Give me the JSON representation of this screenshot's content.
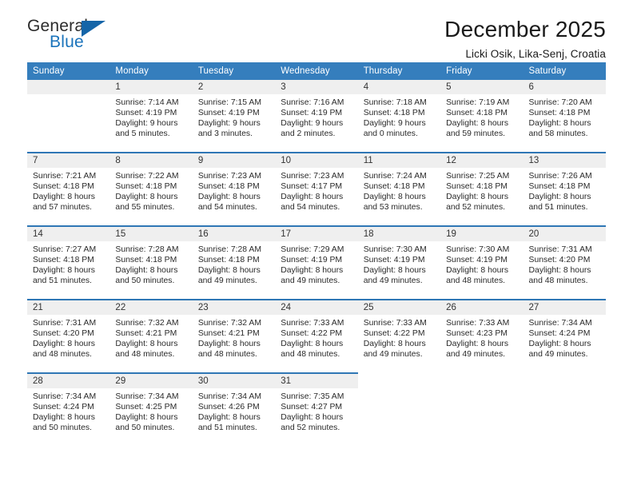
{
  "brand": {
    "name_part1": "General",
    "name_part2": "Blue",
    "triangle_icon": "blue-triangle-icon",
    "accent_color": "#1a73bb"
  },
  "header": {
    "title": "December 2025",
    "subtitle": "Licki Osik, Lika-Senj, Croatia"
  },
  "calendar": {
    "header_bg": "#357ebd",
    "header_text_color": "#ffffff",
    "separator_color": "#2f77b5",
    "daynum_band_bg": "#efefef",
    "weekday_headers": [
      "Sunday",
      "Monday",
      "Tuesday",
      "Wednesday",
      "Thursday",
      "Friday",
      "Saturday"
    ],
    "weeks": [
      [
        {
          "day": "",
          "lines": []
        },
        {
          "day": "1",
          "lines": [
            "Sunrise: 7:14 AM",
            "Sunset: 4:19 PM",
            "Daylight: 9 hours",
            "and 5 minutes."
          ]
        },
        {
          "day": "2",
          "lines": [
            "Sunrise: 7:15 AM",
            "Sunset: 4:19 PM",
            "Daylight: 9 hours",
            "and 3 minutes."
          ]
        },
        {
          "day": "3",
          "lines": [
            "Sunrise: 7:16 AM",
            "Sunset: 4:19 PM",
            "Daylight: 9 hours",
            "and 2 minutes."
          ]
        },
        {
          "day": "4",
          "lines": [
            "Sunrise: 7:18 AM",
            "Sunset: 4:18 PM",
            "Daylight: 9 hours",
            "and 0 minutes."
          ]
        },
        {
          "day": "5",
          "lines": [
            "Sunrise: 7:19 AM",
            "Sunset: 4:18 PM",
            "Daylight: 8 hours",
            "and 59 minutes."
          ]
        },
        {
          "day": "6",
          "lines": [
            "Sunrise: 7:20 AM",
            "Sunset: 4:18 PM",
            "Daylight: 8 hours",
            "and 58 minutes."
          ]
        }
      ],
      [
        {
          "day": "7",
          "lines": [
            "Sunrise: 7:21 AM",
            "Sunset: 4:18 PM",
            "Daylight: 8 hours",
            "and 57 minutes."
          ]
        },
        {
          "day": "8",
          "lines": [
            "Sunrise: 7:22 AM",
            "Sunset: 4:18 PM",
            "Daylight: 8 hours",
            "and 55 minutes."
          ]
        },
        {
          "day": "9",
          "lines": [
            "Sunrise: 7:23 AM",
            "Sunset: 4:18 PM",
            "Daylight: 8 hours",
            "and 54 minutes."
          ]
        },
        {
          "day": "10",
          "lines": [
            "Sunrise: 7:23 AM",
            "Sunset: 4:17 PM",
            "Daylight: 8 hours",
            "and 54 minutes."
          ]
        },
        {
          "day": "11",
          "lines": [
            "Sunrise: 7:24 AM",
            "Sunset: 4:18 PM",
            "Daylight: 8 hours",
            "and 53 minutes."
          ]
        },
        {
          "day": "12",
          "lines": [
            "Sunrise: 7:25 AM",
            "Sunset: 4:18 PM",
            "Daylight: 8 hours",
            "and 52 minutes."
          ]
        },
        {
          "day": "13",
          "lines": [
            "Sunrise: 7:26 AM",
            "Sunset: 4:18 PM",
            "Daylight: 8 hours",
            "and 51 minutes."
          ]
        }
      ],
      [
        {
          "day": "14",
          "lines": [
            "Sunrise: 7:27 AM",
            "Sunset: 4:18 PM",
            "Daylight: 8 hours",
            "and 51 minutes."
          ]
        },
        {
          "day": "15",
          "lines": [
            "Sunrise: 7:28 AM",
            "Sunset: 4:18 PM",
            "Daylight: 8 hours",
            "and 50 minutes."
          ]
        },
        {
          "day": "16",
          "lines": [
            "Sunrise: 7:28 AM",
            "Sunset: 4:18 PM",
            "Daylight: 8 hours",
            "and 49 minutes."
          ]
        },
        {
          "day": "17",
          "lines": [
            "Sunrise: 7:29 AM",
            "Sunset: 4:19 PM",
            "Daylight: 8 hours",
            "and 49 minutes."
          ]
        },
        {
          "day": "18",
          "lines": [
            "Sunrise: 7:30 AM",
            "Sunset: 4:19 PM",
            "Daylight: 8 hours",
            "and 49 minutes."
          ]
        },
        {
          "day": "19",
          "lines": [
            "Sunrise: 7:30 AM",
            "Sunset: 4:19 PM",
            "Daylight: 8 hours",
            "and 48 minutes."
          ]
        },
        {
          "day": "20",
          "lines": [
            "Sunrise: 7:31 AM",
            "Sunset: 4:20 PM",
            "Daylight: 8 hours",
            "and 48 minutes."
          ]
        }
      ],
      [
        {
          "day": "21",
          "lines": [
            "Sunrise: 7:31 AM",
            "Sunset: 4:20 PM",
            "Daylight: 8 hours",
            "and 48 minutes."
          ]
        },
        {
          "day": "22",
          "lines": [
            "Sunrise: 7:32 AM",
            "Sunset: 4:21 PM",
            "Daylight: 8 hours",
            "and 48 minutes."
          ]
        },
        {
          "day": "23",
          "lines": [
            "Sunrise: 7:32 AM",
            "Sunset: 4:21 PM",
            "Daylight: 8 hours",
            "and 48 minutes."
          ]
        },
        {
          "day": "24",
          "lines": [
            "Sunrise: 7:33 AM",
            "Sunset: 4:22 PM",
            "Daylight: 8 hours",
            "and 48 minutes."
          ]
        },
        {
          "day": "25",
          "lines": [
            "Sunrise: 7:33 AM",
            "Sunset: 4:22 PM",
            "Daylight: 8 hours",
            "and 49 minutes."
          ]
        },
        {
          "day": "26",
          "lines": [
            "Sunrise: 7:33 AM",
            "Sunset: 4:23 PM",
            "Daylight: 8 hours",
            "and 49 minutes."
          ]
        },
        {
          "day": "27",
          "lines": [
            "Sunrise: 7:34 AM",
            "Sunset: 4:24 PM",
            "Daylight: 8 hours",
            "and 49 minutes."
          ]
        }
      ],
      [
        {
          "day": "28",
          "lines": [
            "Sunrise: 7:34 AM",
            "Sunset: 4:24 PM",
            "Daylight: 8 hours",
            "and 50 minutes."
          ]
        },
        {
          "day": "29",
          "lines": [
            "Sunrise: 7:34 AM",
            "Sunset: 4:25 PM",
            "Daylight: 8 hours",
            "and 50 minutes."
          ]
        },
        {
          "day": "30",
          "lines": [
            "Sunrise: 7:34 AM",
            "Sunset: 4:26 PM",
            "Daylight: 8 hours",
            "and 51 minutes."
          ]
        },
        {
          "day": "31",
          "lines": [
            "Sunrise: 7:35 AM",
            "Sunset: 4:27 PM",
            "Daylight: 8 hours",
            "and 52 minutes."
          ]
        },
        {
          "day": "",
          "lines": []
        },
        {
          "day": "",
          "lines": []
        },
        {
          "day": "",
          "lines": []
        }
      ]
    ]
  }
}
